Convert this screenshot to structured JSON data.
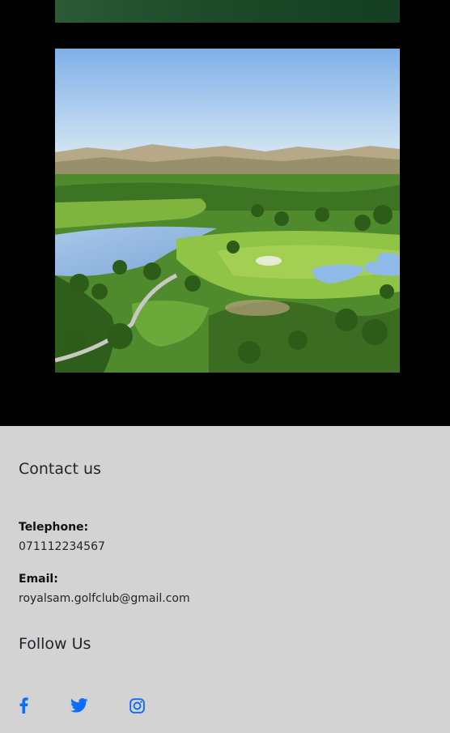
{
  "contact": {
    "heading": "Contact us",
    "telephone_label": "Telephone:",
    "telephone_value": "071112234567",
    "email_label": "Email:",
    "email_value": "royalsam.golfclub@gmail.com"
  },
  "follow": {
    "heading": "Follow Us",
    "icons": [
      "facebook-icon",
      "twitter-icon",
      "instagram-icon"
    ]
  },
  "colors": {
    "page_background": "#000000",
    "footer_background": "#d3d3d3",
    "social_icon": "#0d6efd"
  }
}
